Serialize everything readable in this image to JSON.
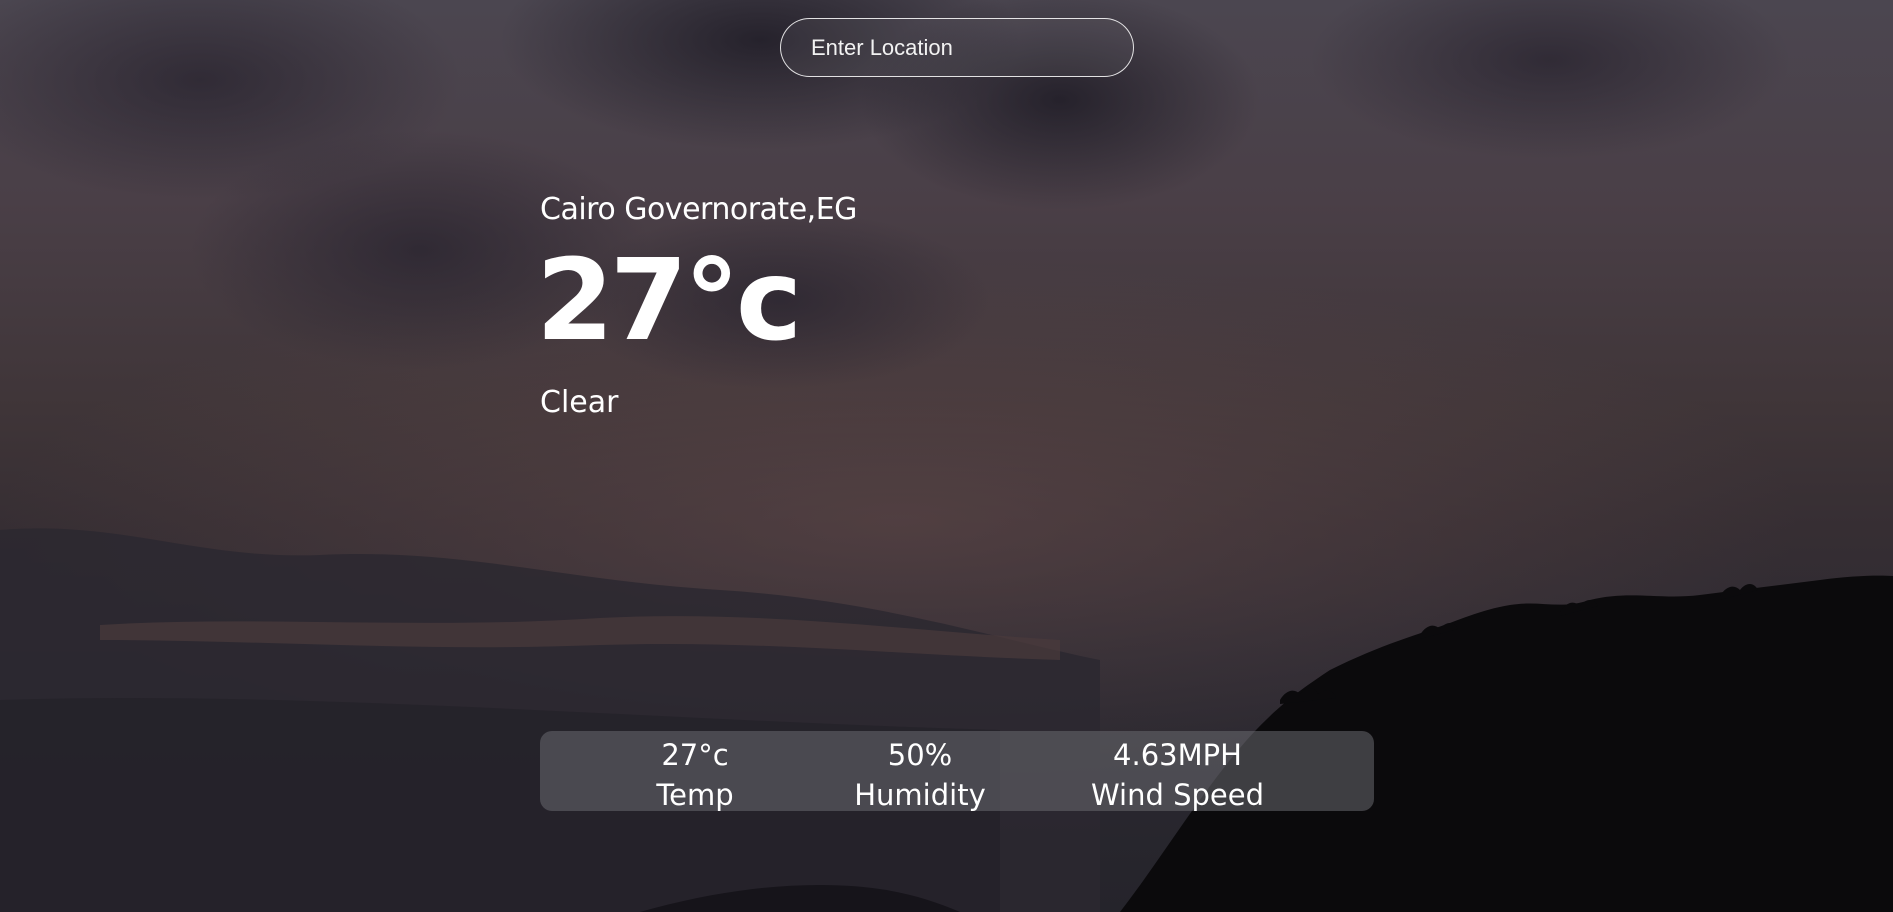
{
  "search": {
    "placeholder": "Enter Location"
  },
  "weather": {
    "location": "Cairo Governorate,EG",
    "temperature": "27°c",
    "condition": "Clear"
  },
  "stats": {
    "temp_value": "27°c",
    "temp_label": "Temp",
    "humidity_value": "50%",
    "humidity_label": "Humidity",
    "wind_value": "4.63MPH",
    "wind_label": "Wind Speed"
  },
  "icons": {
    "background": "night-sky-crescent-moon-image"
  }
}
